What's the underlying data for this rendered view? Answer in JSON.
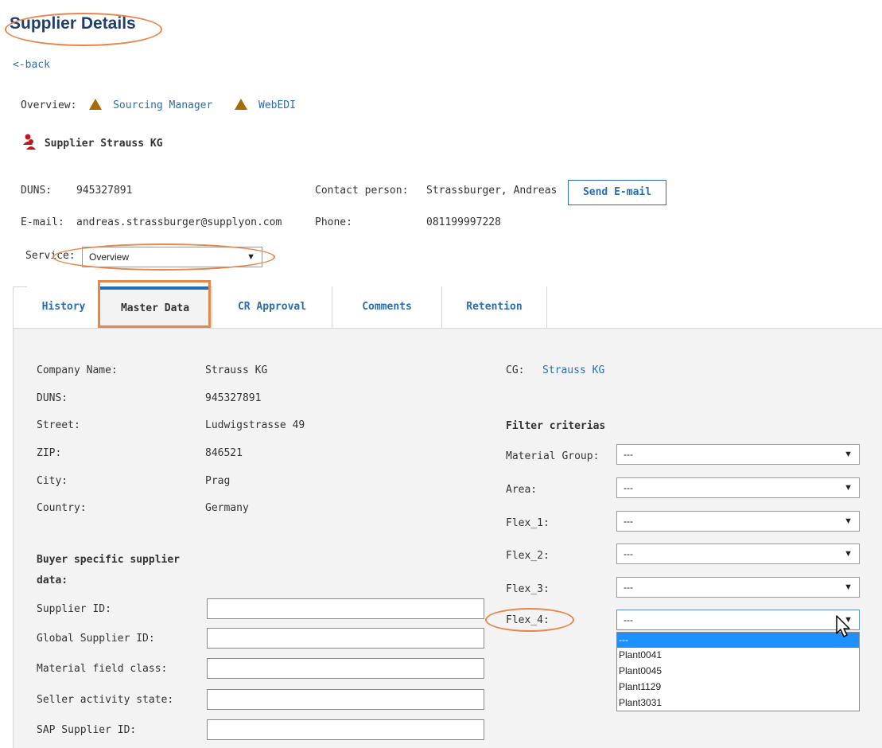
{
  "page": {
    "title": "Supplier Details",
    "back_label": "<-back",
    "overview_label": "Overview:",
    "overview_links": [
      "Sourcing Manager",
      "WebEDI"
    ],
    "supplier_name": "Supplier Strauss KG"
  },
  "info": {
    "duns_label": "DUNS:",
    "duns_value": "945327891",
    "email_label": "E-mail:",
    "email_value": "andreas.strassburger@supplyon.com",
    "contact_label": "Contact person:",
    "contact_value": "Strassburger, Andreas",
    "phone_label": "Phone:",
    "phone_value": "081199997228",
    "send_email_label": "Send E-mail",
    "service_label": "Service:",
    "service_value": "Overview"
  },
  "tabs": [
    "History",
    "Master Data",
    "CR Approval",
    "Comments",
    "Retention"
  ],
  "active_tab": "Master Data",
  "master": {
    "rows": [
      {
        "label": "Company Name:",
        "value": "Strauss KG"
      },
      {
        "label": "DUNS:",
        "value": "945327891"
      },
      {
        "label": "Street:",
        "value": "Ludwigstrasse 49"
      },
      {
        "label": "ZIP:",
        "value": "846521"
      },
      {
        "label": "City:",
        "value": "Prag"
      },
      {
        "label": "Country:",
        "value": "Germany"
      }
    ],
    "cg_label": "CG:",
    "cg_value": "Strauss KG",
    "buyer_heading_1": "Buyer specific supplier",
    "buyer_heading_2": "data:",
    "buyer_fields": [
      "Supplier ID:",
      "Global Supplier ID:",
      "Material field class:",
      "Seller activity state:",
      "SAP Supplier ID:"
    ]
  },
  "filters": {
    "heading": "Filter criterias",
    "items": [
      {
        "label": "Material Group:",
        "value": "---"
      },
      {
        "label": "Area:",
        "value": "---"
      },
      {
        "label": "Flex_1:",
        "value": "---"
      },
      {
        "label": "Flex_2:",
        "value": "---"
      },
      {
        "label": "Flex_3:",
        "value": "---"
      },
      {
        "label": "Flex_4:",
        "value": "---"
      }
    ],
    "flex4_options": [
      "---",
      "Plant0041",
      "Plant0045",
      "Plant1129",
      "Plant3031"
    ],
    "flex4_highlighted": "---"
  },
  "colors": {
    "link": "#2a6db0",
    "tab_active_bar": "#1f6fb8",
    "annotation_orange": "#e8864a",
    "list_highlight": "#1e90ff"
  },
  "icons": {
    "warning": "warning-triangle-icon",
    "supplier": "supplier-person-icon",
    "cursor": "mouse-cursor-icon"
  }
}
